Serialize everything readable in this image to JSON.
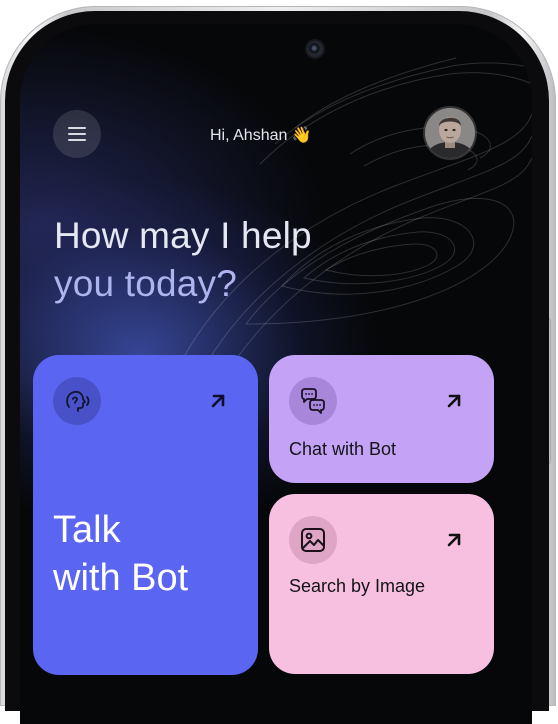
{
  "header": {
    "greeting": "Hi, Ahshan",
    "greeting_emoji": "👋",
    "avatar_alt": "user avatar"
  },
  "hero": {
    "line1": "How may I help",
    "line2": "you today?"
  },
  "cards": {
    "talk": {
      "label_line1": "Talk",
      "label_line2": "with Bot",
      "icon": "speaking-head-icon"
    },
    "chat": {
      "label": "Chat with Bot",
      "icon": "chat-bubbles-icon"
    },
    "image": {
      "label": "Search by Image",
      "icon": "image-icon"
    }
  },
  "colors": {
    "background": "#060709",
    "talk_card": "#5a66f2",
    "chat_card": "#c4a2f6",
    "image_card": "#f7bfe0",
    "headline_primary": "#e5e7f2",
    "headline_accent": "#aeb4ee"
  }
}
